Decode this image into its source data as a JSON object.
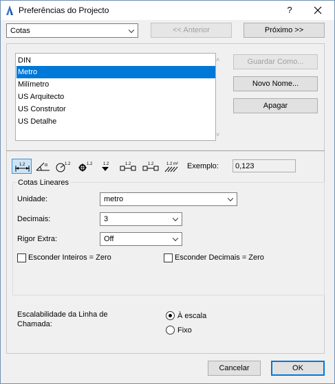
{
  "window": {
    "title": "Preferências do Projecto",
    "help": "?",
    "close": "✕"
  },
  "topbar": {
    "category": "Cotas",
    "prev_label": "<< Anterior",
    "next_label": "Próximo >>"
  },
  "preset_list": {
    "items": [
      "DIN",
      "Metro",
      "Milímetro",
      "US Arquitecto",
      "US Construtor",
      "US Detalhe"
    ],
    "selected": "Metro"
  },
  "side_buttons": {
    "save_as": "Guardar Como...",
    "rename": "Novo Nome...",
    "delete": "Apagar"
  },
  "toolbar": {
    "tools": [
      "linear-dimension",
      "angular-dimension",
      "radial-dimension",
      "level-dimension",
      "elevation-dimension",
      "door-window-dimension",
      "sill-height-dimension",
      "area-calculation"
    ],
    "selected_tool": "linear-dimension",
    "example_label": "Exemplo:",
    "example_value": "0,123"
  },
  "linear": {
    "group_title": "Cotas Lineares",
    "unit_label": "Unidade:",
    "unit_value": "metro",
    "decimals_label": "Decimais:",
    "decimals_value": "3",
    "extra_label": "Rigor Extra:",
    "extra_value": "Off",
    "hide_int_label": "Esconder Inteiros = Zero",
    "hide_int_checked": false,
    "hide_dec_label": "Esconder Decimais = Zero",
    "hide_dec_checked": false
  },
  "leader": {
    "label_line1": "Escalabilidade da Linha de",
    "label_line2": "Chamada:",
    "option_scale": "À escala",
    "option_fixed": "Fixo",
    "selected": "À escala"
  },
  "footer": {
    "cancel": "Cancelar",
    "ok": "OK"
  },
  "colors": {
    "selection": "#0078d7",
    "default_border": "#0078d7"
  }
}
